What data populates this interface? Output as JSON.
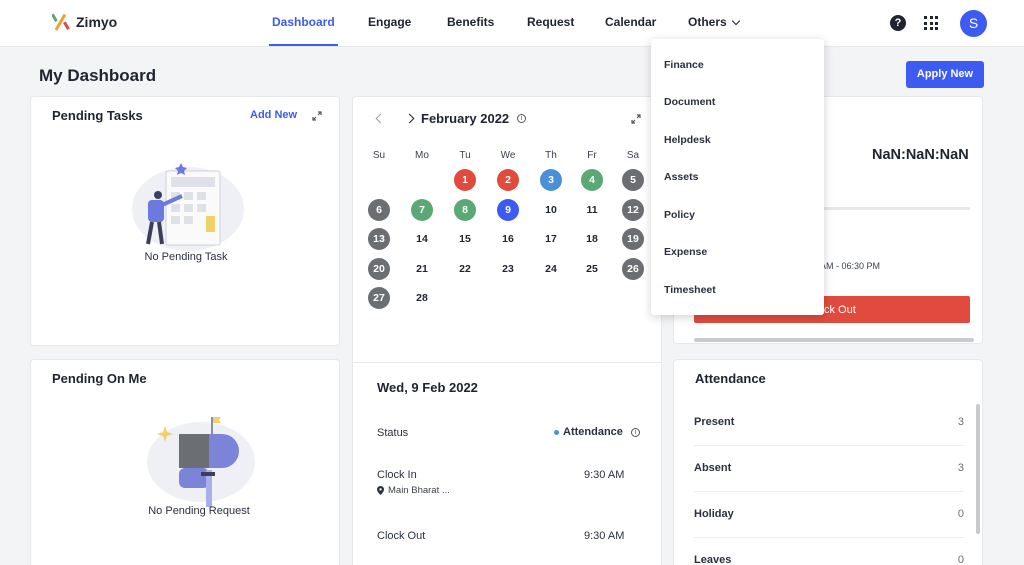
{
  "brand": {
    "name": "Zimyo"
  },
  "nav": {
    "items": [
      "Dashboard",
      "Engage",
      "Benefits",
      "Request",
      "Calendar",
      "Others"
    ],
    "active": "Dashboard",
    "avatar_initial": "S",
    "help_glyph": "?"
  },
  "page": {
    "title": "My Dashboard",
    "apply_button": "Apply New"
  },
  "pending_tasks": {
    "title": "Pending Tasks",
    "add_new": "Add New",
    "empty_text": "No Pending Task"
  },
  "pending_on_me": {
    "title": "Pending On Me",
    "empty_text": "No Pending Request"
  },
  "calendar": {
    "month": "February 2022",
    "weekdays": [
      "Su",
      "Mo",
      "Tu",
      "We",
      "Th",
      "Fr",
      "Sa"
    ],
    "days": [
      {
        "d": "1",
        "c": "red"
      },
      {
        "d": "2",
        "c": "red"
      },
      {
        "d": "3",
        "c": "blue"
      },
      {
        "d": "4",
        "c": "green"
      },
      {
        "d": "5",
        "c": "grey"
      },
      {
        "d": "6",
        "c": "grey"
      },
      {
        "d": "7",
        "c": "green"
      },
      {
        "d": "8",
        "c": "green"
      },
      {
        "d": "9",
        "c": "royal"
      },
      {
        "d": "10",
        "c": ""
      },
      {
        "d": "11",
        "c": ""
      },
      {
        "d": "12",
        "c": "grey"
      },
      {
        "d": "13",
        "c": "grey"
      },
      {
        "d": "14",
        "c": ""
      },
      {
        "d": "15",
        "c": ""
      },
      {
        "d": "16",
        "c": ""
      },
      {
        "d": "17",
        "c": ""
      },
      {
        "d": "18",
        "c": ""
      },
      {
        "d": "19",
        "c": "grey"
      },
      {
        "d": "20",
        "c": "grey"
      },
      {
        "d": "21",
        "c": ""
      },
      {
        "d": "22",
        "c": ""
      },
      {
        "d": "23",
        "c": ""
      },
      {
        "d": "24",
        "c": ""
      },
      {
        "d": "25",
        "c": ""
      },
      {
        "d": "26",
        "c": "grey"
      },
      {
        "d": "27",
        "c": "grey"
      },
      {
        "d": "28",
        "c": ""
      }
    ],
    "first_weekday_index": 2
  },
  "day_detail": {
    "date": "Wed, 9 Feb 2022",
    "status_label": "Status",
    "status_value": "Attendance",
    "clock_in_label": "Clock In",
    "clock_in_time": "9:30 AM",
    "clock_in_location": "Main Bharat ...",
    "clock_out_label": "Clock Out",
    "clock_out_time": "9:30 AM"
  },
  "timer": {
    "value": "NaN:NaN:NaN",
    "shift_fragment": "AM - 06:30 PM",
    "checkout_fragment": "ck Out"
  },
  "others_menu": [
    "Finance",
    "Document",
    "Helpdesk",
    "Assets",
    "Policy",
    "Expense",
    "Timesheet"
  ],
  "attendance": {
    "title": "Attendance",
    "rows": [
      {
        "label": "Present",
        "value": "3"
      },
      {
        "label": "Absent",
        "value": "3"
      },
      {
        "label": "Holiday",
        "value": "0"
      },
      {
        "label": "Leaves",
        "value": "0"
      }
    ]
  },
  "colors": {
    "accent": "#3d5af1",
    "danger": "#e04b3e",
    "present": "#5aa874",
    "info": "#4a90d9",
    "weekend": "#6b6e73"
  }
}
